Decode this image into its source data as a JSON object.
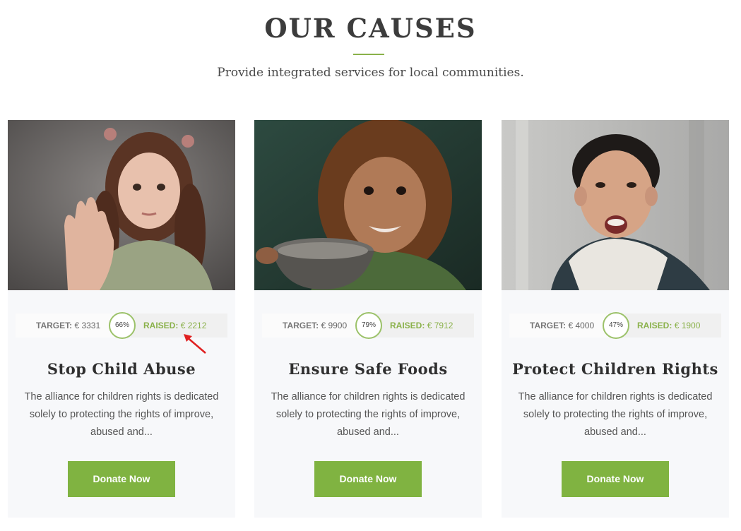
{
  "header": {
    "title": "OUR CAUSES",
    "subtitle": "Provide integrated services for local communities."
  },
  "causes": [
    {
      "target_label": "TARGET:",
      "target_value": "€ 3331",
      "percent": "66%",
      "raised_label": "RAISED:",
      "raised_value": "€ 2212",
      "title": "Stop Child Abuse",
      "description": "The alliance for children rights is dedicated solely to protecting the rights of improve, abused and...",
      "button_label": "Donate Now"
    },
    {
      "target_label": "TARGET:",
      "target_value": "€ 9900",
      "percent": "79%",
      "raised_label": "RAISED:",
      "raised_value": "€ 7912",
      "title": "Ensure Safe Foods",
      "description": "The alliance for children rights is dedicated solely to protecting the rights of improve, abused and...",
      "button_label": "Donate Now"
    },
    {
      "target_label": "TARGET:",
      "target_value": "€ 4000",
      "percent": "47%",
      "raised_label": "RAISED:",
      "raised_value": "€ 1900",
      "title": "Protect Children Rights",
      "description": "The alliance for children rights is dedicated solely to protecting the rights of improve, abused and...",
      "button_label": "Donate Now"
    }
  ],
  "colors": {
    "accent": "#80b341",
    "title": "#3c3c3c",
    "card_bg": "#f7f8fa",
    "annotation": "#e02020"
  }
}
